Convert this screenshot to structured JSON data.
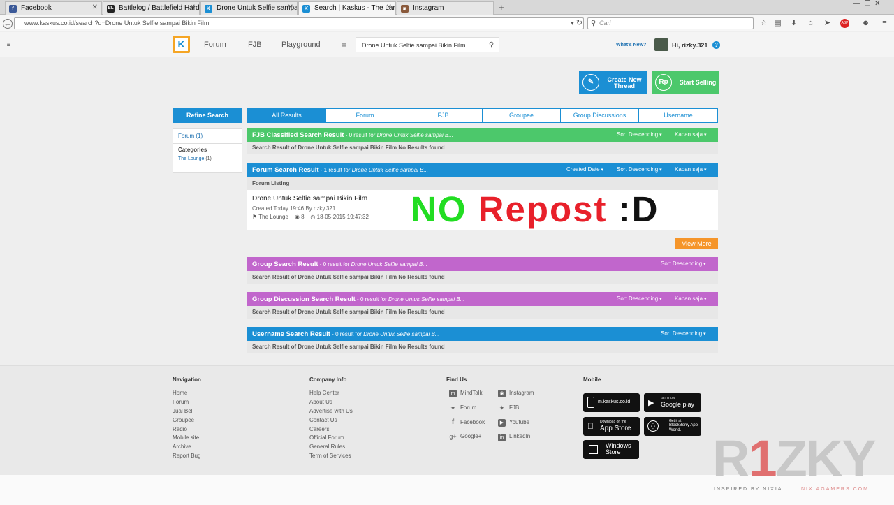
{
  "browser": {
    "tabs": [
      {
        "title": "Facebook",
        "icon": "facebook-icon",
        "color": "#3b5998",
        "glyph": "f"
      },
      {
        "title": "Battlelog / Battlefield Hardl...",
        "icon": "battlelog-icon",
        "color": "#222222",
        "glyph": "BL"
      },
      {
        "title": "Drone Untuk Selfie sampai ...",
        "icon": "kaskus-icon",
        "color": "#1b8fd4",
        "glyph": "K"
      },
      {
        "title": "Search | Kaskus - The Large...",
        "icon": "kaskus-icon",
        "color": "#1b8fd4",
        "glyph": "K"
      },
      {
        "title": "Instagram",
        "icon": "instagram-icon",
        "color": "#8a5a3c",
        "glyph": "◙"
      }
    ],
    "url": "www.kaskus.co.id/search?q=Drone Untuk Selfie sampai Bikin Film",
    "search_placeholder": "Cari"
  },
  "header": {
    "nav": [
      "Forum",
      "FJB",
      "Playground"
    ],
    "search_value": "Drone Untuk Selfie sampai Bikin Film",
    "whats_new": "What's New?",
    "greeting": "Hi, rizky.321",
    "help": "?"
  },
  "actions": {
    "create_line1": "Create New",
    "create_line2": "Thread",
    "sell": "Start Selling",
    "sell_icon": "Rp"
  },
  "sidebar": {
    "refine": "Refine Search",
    "forum_filter": "Forum (1)",
    "categories_label": "Categories",
    "category": "The Lounge",
    "category_count": "(1)"
  },
  "tabs": [
    "All Results",
    "Forum",
    "FJB",
    "Groupee",
    "Group Discussions",
    "Username"
  ],
  "sections": {
    "fjb": {
      "title": "FJB Classified Search Result",
      "count": " - 0 result for ",
      "query": "Drone Untuk Selfie sampai B...",
      "sort": "Sort Descending",
      "time": "Kapan saja",
      "no_results": "Search Result of Drone Untuk Selfie sampai Bikin Film No Results found"
    },
    "forum": {
      "title": "Forum Search Result",
      "count": " - 1 result for ",
      "query": "Drone Untuk Selfie sampai B...",
      "created": "Created Date",
      "sort": "Sort Descending",
      "time": "Kapan saja",
      "listing": "Forum Listing"
    },
    "group": {
      "title": "Group Search Result",
      "count": " - 0 result for ",
      "query": "Drone Untuk Selfie sampai B...",
      "sort": "Sort Descending",
      "no_results": "Search Result of Drone Untuk Selfie sampai Bikin Film No Results found"
    },
    "discussion": {
      "title": "Group Discussion Search Result",
      "count": " - 0 result for ",
      "query": "Drone Untuk Selfie sampai B...",
      "sort": "Sort Descending",
      "time": "Kapan saja",
      "no_results": "Search Result of Drone Untuk Selfie sampai Bikin Film No Results found"
    },
    "username": {
      "title": "Username Search Result",
      "count": " - 0 result for ",
      "query": "Drone Untuk Selfie sampai B...",
      "sort": "Sort Descending",
      "no_results": "Search Result of Drone Untuk Selfie sampai Bikin Film No Results found"
    }
  },
  "thread": {
    "title": "Drone Untuk Selfie sampai Bikin Film",
    "meta": "Created Today 19:46 By rizky.321",
    "category": "The Lounge",
    "views": "8",
    "date": "18-05-2015 19:47:32"
  },
  "overlay": {
    "part1": "NO",
    "part2": "Repost",
    "part3": ":D",
    "green": "#22dd22",
    "red": "#e8202a"
  },
  "view_more": "View More",
  "footer": {
    "navigation": {
      "title": "Navigation",
      "links": [
        "Home",
        "Forum",
        "Jual Beli",
        "Groupee",
        "Radio",
        "Mobile site",
        "Archive",
        "Report Bug"
      ]
    },
    "company": {
      "title": "Company Info",
      "links": [
        "Help Center",
        "About Us",
        "Advertise with Us",
        "Contact Us",
        "Careers",
        "Official Forum",
        "General Rules",
        "Term of Services"
      ]
    },
    "findus": {
      "title": "Find Us",
      "left": [
        "MindTalk",
        "Forum",
        "Facebook",
        "Google+"
      ],
      "right": [
        "Instagram",
        "FJB",
        "Youtube",
        "LinkedIn"
      ]
    },
    "mobile": {
      "title": "Mobile",
      "kaskus": "m.kaskus.co.id",
      "gp_small": "GET IT ON",
      "gp": "Google play",
      "as_small": "Download on the",
      "as": "App Store",
      "bb_small": "Get it at",
      "bb": "BlackBerry App World.",
      "ws1": "Windows",
      "ws2": "Store"
    }
  },
  "watermark": {
    "r": "R",
    "one": "1",
    "rest": "ZKY",
    "inspired": "INSPIRED BY NIXIA",
    "site": "NIXIAGAMERS.COM"
  }
}
